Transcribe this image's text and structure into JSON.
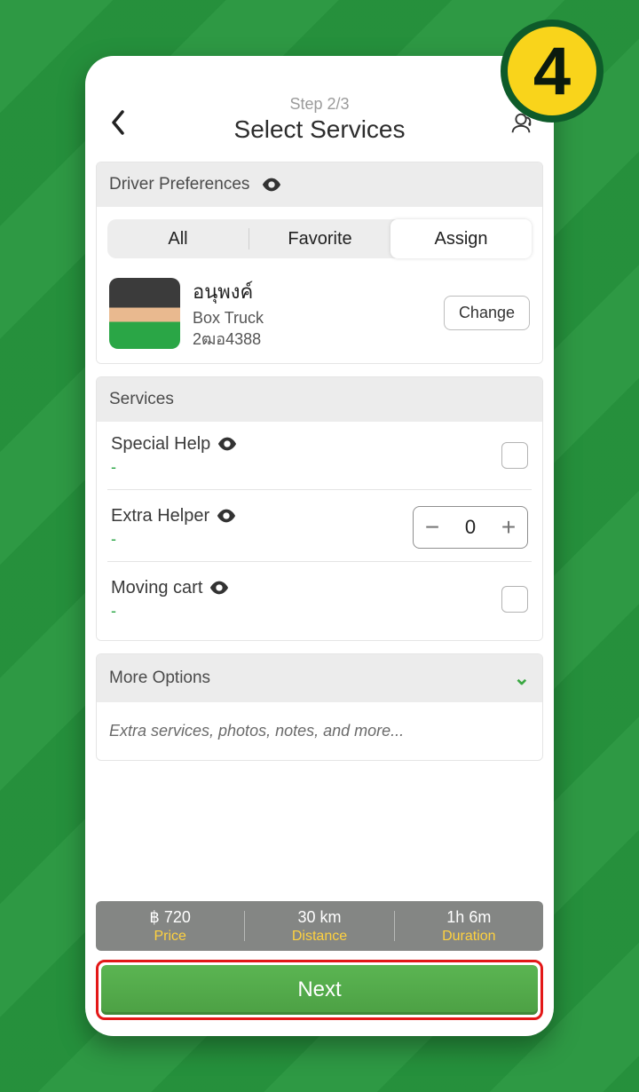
{
  "badge": "4",
  "header": {
    "step_label": "Step 2/3",
    "title": "Select Services"
  },
  "driver_prefs": {
    "section_label": "Driver Preferences",
    "tabs": {
      "all": "All",
      "favorite": "Favorite",
      "assign": "Assign"
    },
    "driver": {
      "name": "อนุพงค์",
      "vehicle_type": "Box Truck",
      "plate": "2ฒอ4388",
      "change_label": "Change"
    }
  },
  "services": {
    "section_label": "Services",
    "items": [
      {
        "title": "Special Help",
        "price_text": "-"
      },
      {
        "title": "Extra Helper",
        "price_text": "-",
        "stepper_value": "0"
      },
      {
        "title": "Moving cart",
        "price_text": "-"
      }
    ]
  },
  "more": {
    "title": "More Options",
    "hint": "Extra services, photos, notes, and more..."
  },
  "summary": {
    "price_value": "฿ 720",
    "price_label": "Price",
    "distance_value": "30 km",
    "distance_label": "Distance",
    "duration_value": "1h 6m",
    "duration_label": "Duration"
  },
  "next_label": "Next"
}
